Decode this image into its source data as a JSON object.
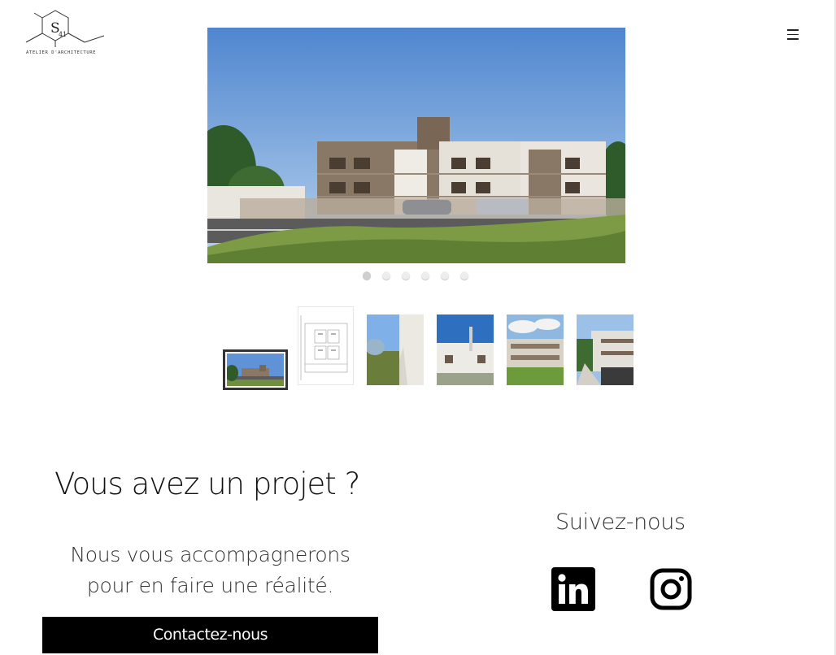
{
  "logo": {
    "main": "S",
    "sub": "41",
    "caption": "ATELIER D'ARCHITECTURE"
  },
  "menu": {
    "icon": "hamburger-menu-icon"
  },
  "carousel": {
    "slide_count": 6,
    "active_index": 0,
    "thumbnails": [
      {
        "kind": "exterior-building",
        "selected": true
      },
      {
        "kind": "floor-plan",
        "selected": false
      },
      {
        "kind": "garden-path",
        "selected": false
      },
      {
        "kind": "facade-stairs",
        "selected": false
      },
      {
        "kind": "balconies-garden",
        "selected": false
      },
      {
        "kind": "street-view",
        "selected": false
      }
    ]
  },
  "contact": {
    "title": "Vous avez un projet ?",
    "line1": "Nous vous accompagnerons",
    "line2": "pour en faire une réalité.",
    "button": "Contactez-nous"
  },
  "social": {
    "title": "Suivez-nous",
    "items": [
      {
        "name": "linkedin-icon"
      },
      {
        "name": "instagram-icon"
      }
    ]
  }
}
